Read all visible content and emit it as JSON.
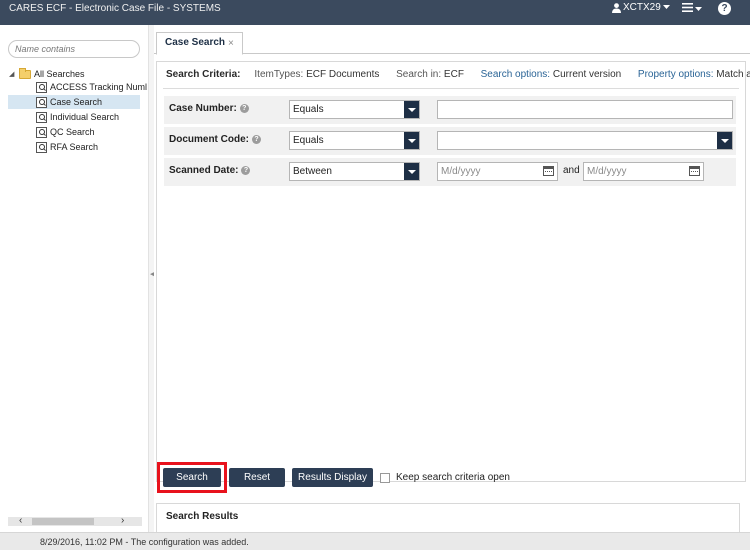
{
  "app": {
    "title": "CARES ECF - Electronic Case File - SYSTEMS"
  },
  "header": {
    "user": "XCTX29",
    "help": "?"
  },
  "sidebar": {
    "search_placeholder": "Name contains",
    "root": "All Searches",
    "items": [
      {
        "label": "ACCESS Tracking Numl"
      },
      {
        "label": "Case Search",
        "selected": true
      },
      {
        "label": "Individual Search"
      },
      {
        "label": "QC Search"
      },
      {
        "label": "RFA Search"
      }
    ]
  },
  "tabs": [
    {
      "label": "Case Search",
      "close": "×"
    }
  ],
  "criteria": {
    "label": "Search Criteria:",
    "item_types_label": "ItemTypes:",
    "item_types_value": "ECF Documents",
    "search_in_label": "Search in:",
    "search_in_value": "ECF",
    "search_options_label": "Search options:",
    "search_options_value": "Current version",
    "property_options_label": "Property options:",
    "property_options_value": "Match all"
  },
  "fields": {
    "case_number": {
      "label": "Case Number:",
      "operator": "Equals",
      "value": ""
    },
    "document_code": {
      "label": "Document Code:",
      "operator": "Equals",
      "value": ""
    },
    "scanned_date": {
      "label": "Scanned Date:",
      "operator": "Between",
      "from_placeholder": "M/d/yyyy",
      "to_placeholder": "M/d/yyyy",
      "and": "and"
    }
  },
  "buttons": {
    "search": "Search",
    "reset": "Reset",
    "results_display": "Results Display",
    "keep_open": "Keep search criteria open"
  },
  "results": {
    "title": "Search Results"
  },
  "status": {
    "message": "8/29/2016, 11:02 PM - The configuration was added."
  }
}
